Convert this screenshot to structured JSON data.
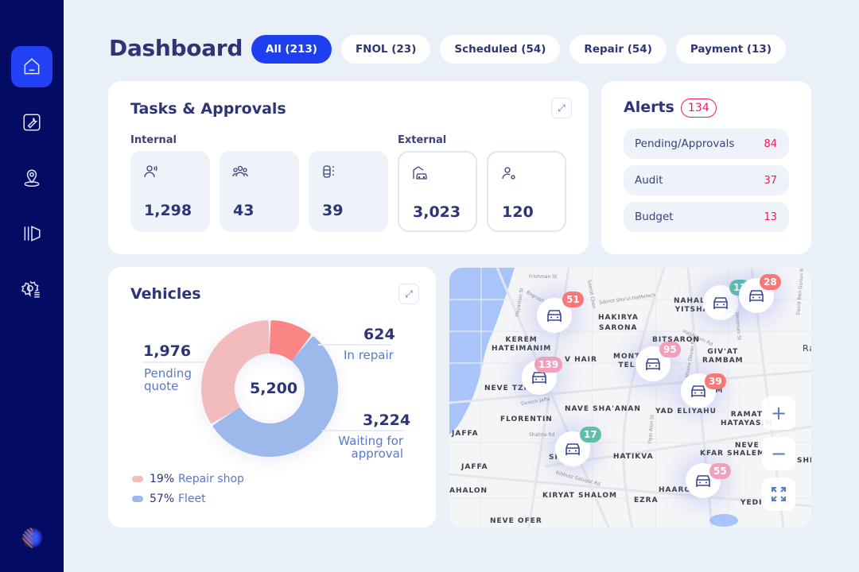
{
  "sidebar": {
    "items": [
      {
        "name": "home",
        "active": true
      },
      {
        "name": "repair"
      },
      {
        "name": "location"
      },
      {
        "name": "map"
      },
      {
        "name": "settings"
      }
    ]
  },
  "header": {
    "title": "Dashboard",
    "filters": [
      "All (213)",
      "FNOL (23)",
      "Scheduled (54)",
      "Repair (54)",
      "Payment (13)"
    ],
    "active_filter": 0
  },
  "tasks": {
    "title": "Tasks & Approvals",
    "internal_label": "Internal",
    "external_label": "External",
    "internal": [
      {
        "icon": "user-voice-icon",
        "value": "1,298"
      },
      {
        "icon": "users-group-icon",
        "value": "43"
      },
      {
        "icon": "car-dashed-icon",
        "value": "39"
      }
    ],
    "external": [
      {
        "icon": "garage-car-icon",
        "value": "3,023"
      },
      {
        "icon": "user-link-icon",
        "value": "120"
      }
    ]
  },
  "alerts": {
    "title": "Alerts",
    "count": "134",
    "items": [
      {
        "label": "Pending/Approvals",
        "value": "84"
      },
      {
        "label": "Audit",
        "value": "37"
      },
      {
        "label": "Budget",
        "value": "13"
      }
    ]
  },
  "vehicles": {
    "title": "Vehicles",
    "total": "5,200",
    "segments": [
      {
        "value": "1,976",
        "label1": "Pending",
        "label2": "quote",
        "color": "#f3bcbc"
      },
      {
        "value": "624",
        "label1": "In repair",
        "label2": "",
        "color": "#fb8585"
      },
      {
        "value": "3,224",
        "label1": "Waiting for",
        "label2": "approval",
        "color": "#9db8ea"
      }
    ],
    "legend": [
      {
        "pct": "19%",
        "label": "Repair shop",
        "color": "#f3bcbc"
      },
      {
        "pct": "57%",
        "label": "Fleet",
        "color": "#9db8ea"
      }
    ]
  },
  "map": {
    "areas": [
      "NAHALAT\nYITSHAK",
      "HAKIRYA",
      "SARONA",
      "KEREM\nHATEIMANIM",
      "BITSARON",
      "GIV'AT\nRAMBAM",
      "MONTEFIORE\nTEL A",
      "NEVE TZEDEK",
      "NAVE SHA'ANAN",
      "YAD ELIYAHU",
      "RAMAT\nHATAYASIM",
      "FLORENTIN",
      "JAFFA",
      "JAFFA",
      "HATIKVA",
      "NEVE HE",
      "KFAR SHALEM",
      "AHALON",
      "KIRYAT SHALOM",
      "HAARGAZ",
      "EZRA",
      "YEDIDY",
      "NEVE OFER",
      "V HAIR",
      "SH",
      "IM",
      "SHIK",
      "Ra"
    ],
    "streets": [
      "Frishman St",
      "Bograshov",
      "Hayarkon St",
      "Sderot Chen",
      "Sderot Sha'ul HaMelech",
      "HaShalom Rd",
      "Moshe Dayan Rd",
      "Weizman St",
      "David Ben Gurion Rd",
      "Derech Jaffa",
      "Shalma Rd",
      "Kibbutz Galuyot Rd",
      "Yigal Alon St"
    ],
    "markers": [
      {
        "count": "51",
        "color": "#f87878"
      },
      {
        "count": "17",
        "color": "#5dbfa9"
      },
      {
        "count": "28",
        "color": "#f87878"
      },
      {
        "count": "139",
        "color": "#f0a0ba"
      },
      {
        "count": "95",
        "color": "#f0a0ba"
      },
      {
        "count": "39",
        "color": "#f87878"
      },
      {
        "count": "17",
        "color": "#5dbfa9"
      },
      {
        "count": "55",
        "color": "#f0a0ba"
      }
    ],
    "controls": {
      "zoom_in": "+",
      "zoom_out": "−"
    }
  }
}
